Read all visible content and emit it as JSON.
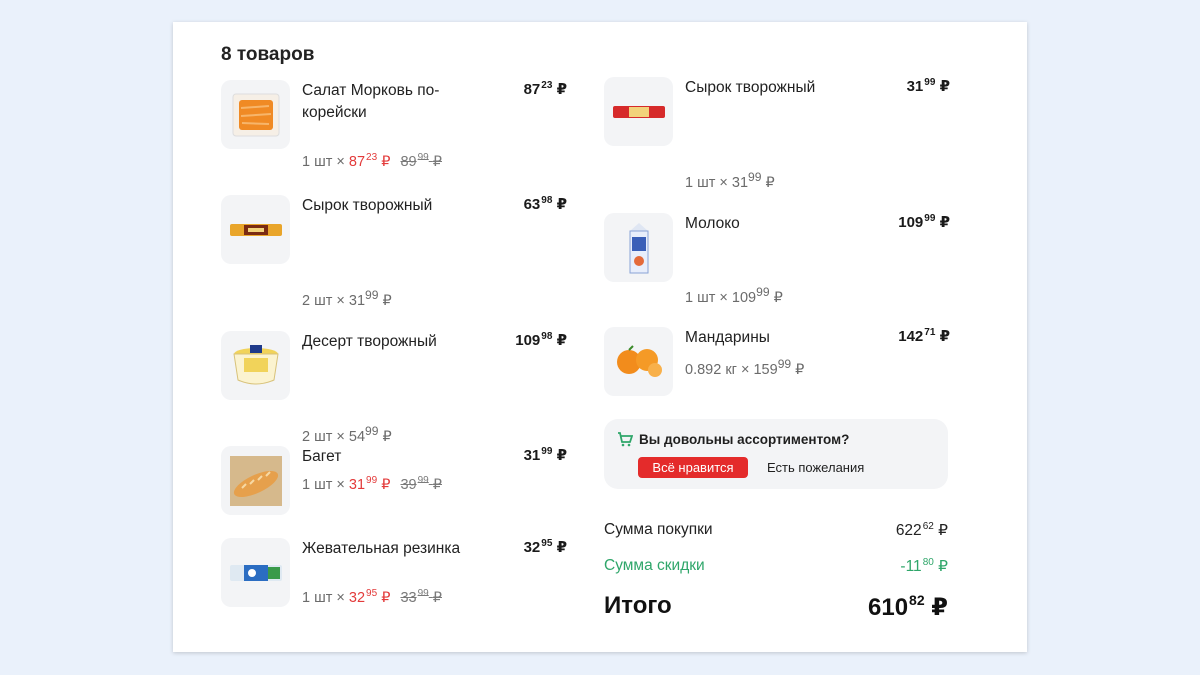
{
  "header": {
    "title": "8 товаров"
  },
  "currency": "₽",
  "left_items": [
    {
      "name": "Салат Морковь по-корейски",
      "total_int": "87",
      "total_dec": "23",
      "qty": "1 шт ×",
      "unit_int": "87",
      "unit_dec": "23",
      "old_int": "89",
      "old_dec": "99",
      "icon": "carrot-salad-image"
    },
    {
      "name": "Сырок творожный",
      "total_int": "63",
      "total_dec": "98",
      "qty": "2 шт ×",
      "unit_int": "31",
      "unit_dec": "99",
      "icon": "cheese-bar-image"
    },
    {
      "name": "Десерт творожный",
      "total_int": "109",
      "total_dec": "98",
      "qty": "2 шт ×",
      "unit_int": "54",
      "unit_dec": "99",
      "icon": "curd-dessert-cup-image"
    },
    {
      "name": "Багет",
      "total_int": "31",
      "total_dec": "99",
      "qty": "1 шт ×",
      "unit_int": "31",
      "unit_dec": "99",
      "old_int": "39",
      "old_dec": "99",
      "icon": "baguette-image"
    },
    {
      "name": "Жевательная резинка",
      "total_int": "32",
      "total_dec": "95",
      "qty": "1 шт ×",
      "unit_int": "32",
      "unit_dec": "95",
      "old_int": "33",
      "old_dec": "99",
      "icon": "chewing-gum-image"
    }
  ],
  "right_items": [
    {
      "name": "Сырок творожный",
      "total_int": "31",
      "total_dec": "99",
      "qty": "1 шт ×",
      "unit_int": "31",
      "unit_dec": "99",
      "icon": "cheese-bar-image"
    },
    {
      "name": "Молоко",
      "total_int": "109",
      "total_dec": "99",
      "qty": "1 шт ×",
      "unit_int": "109",
      "unit_dec": "99",
      "icon": "milk-carton-image"
    },
    {
      "name": "Мандарины",
      "total_int": "142",
      "total_dec": "71",
      "qty": "0.892 кг ×",
      "unit_int": "159",
      "unit_dec": "99",
      "icon": "tangerines-image"
    }
  ],
  "survey": {
    "question": "Вы довольны ассортиментом?",
    "like_label": "Всё нравится",
    "wish_label": "Есть пожелания",
    "accent": "#e42b2b"
  },
  "summary": {
    "purchase_label": "Сумма покупки",
    "purchase_int": "622",
    "purchase_dec": "62",
    "discount_label": "Сумма скидки",
    "discount_int": "-11",
    "discount_dec": "80",
    "total_label": "Итого",
    "total_int": "610",
    "total_dec": "82",
    "discount_color": "#2fa66a"
  }
}
